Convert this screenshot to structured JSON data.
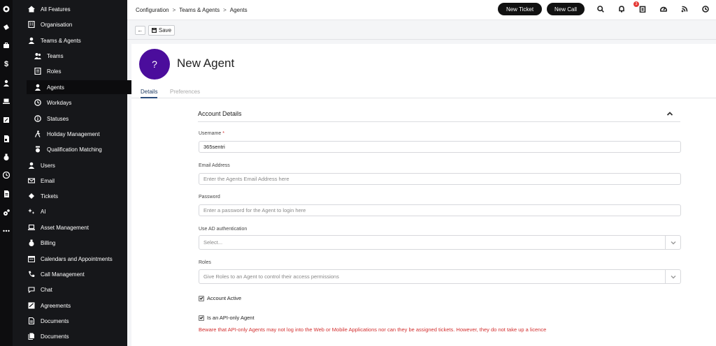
{
  "sidebar": {
    "items": [
      {
        "label": "All Features",
        "icon": "home-icon"
      },
      {
        "label": "Organisation",
        "icon": "building-icon"
      },
      {
        "label": "Teams & Agents",
        "icon": "person-icon"
      },
      {
        "label": "Teams",
        "icon": "people-icon"
      },
      {
        "label": "Roles",
        "icon": "roles-icon"
      },
      {
        "label": "Agents",
        "icon": "person-icon"
      },
      {
        "label": "Workdays",
        "icon": "clock-icon"
      },
      {
        "label": "Statuses",
        "icon": "info-icon"
      },
      {
        "label": "Holiday Management",
        "icon": "walking-icon"
      },
      {
        "label": "Qualification Matching",
        "icon": "badge-icon"
      },
      {
        "label": "Users",
        "icon": "person-icon"
      },
      {
        "label": "Email",
        "icon": "email-icon"
      },
      {
        "label": "Tickets",
        "icon": "ticket-icon"
      },
      {
        "label": "AI",
        "icon": "sparkle-icon"
      },
      {
        "label": "Asset Management",
        "icon": "laptop-icon"
      },
      {
        "label": "Billing",
        "icon": "money-bag-icon"
      },
      {
        "label": "Calendars and Appointments",
        "icon": "calendar-icon"
      },
      {
        "label": "Call Management",
        "icon": "phone-icon"
      },
      {
        "label": "Chat",
        "icon": "chat-icon"
      },
      {
        "label": "Agreements",
        "icon": "agreement-icon"
      },
      {
        "label": "Documents",
        "icon": "document-icon"
      },
      {
        "label": "Documents",
        "icon": "documents-icon"
      }
    ],
    "active_index": 5
  },
  "header": {
    "breadcrumb": [
      "Configuration",
      "Teams & Agents",
      "Agents"
    ],
    "new_ticket": "New Ticket",
    "new_call": "New Call",
    "notification_badge": "3"
  },
  "toolbar": {
    "back": "←",
    "save": "Save"
  },
  "agent": {
    "avatar_text": "?",
    "title": "New Agent"
  },
  "tabs": [
    "Details",
    "Preferences"
  ],
  "form": {
    "section_title": "Account Details",
    "username_label": "Username",
    "required_mark": "*",
    "username_value": "365sentri",
    "email_label": "Email Address",
    "email_placeholder": "Enter the Agents Email Address here",
    "password_label": "Password",
    "password_placeholder": "Enter a password for the Agent to login here",
    "ad_label": "Use AD authentication",
    "ad_placeholder": "Select...",
    "roles_label": "Roles",
    "roles_placeholder": "Give Roles to an Agent to control their access permissions",
    "account_active_label": "Account Active",
    "account_active": true,
    "api_only_label": "Is an API-only Agent",
    "api_only": true,
    "warning": "Beware that API-only Agents may not log into the Web or Mobile Applications nor can they be assigned tickets. However, they do not take up a licence"
  },
  "colors": {
    "avatar": "#4b0d9c",
    "warning": "#d32f2f",
    "sidebar": "#16171a",
    "active_tab": "#2b4d7c"
  }
}
